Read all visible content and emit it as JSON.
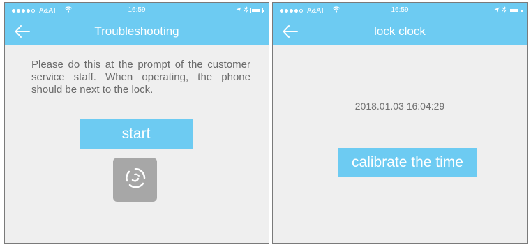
{
  "status_bar": {
    "carrier": "A&AT",
    "time": "16:59"
  },
  "left_screen": {
    "title": "Troubleshooting",
    "instruction": "Please do this at the prompt of the customer service staff. When operating, the phone should be next to the lock.",
    "start_label": "start"
  },
  "right_screen": {
    "title": "lock clock",
    "datetime": "2018.01.03 16:04:29",
    "calibrate_label": "calibrate the time"
  },
  "colors": {
    "accent": "#6dcbf2",
    "background": "#efefef",
    "text": "#6a6a6a",
    "spinner_box": "#a7a7a7"
  },
  "icons": [
    "back-arrow-icon",
    "wifi-icon",
    "location-arrow-icon",
    "bluetooth-icon",
    "battery-icon",
    "loading-spinner-icon"
  ]
}
